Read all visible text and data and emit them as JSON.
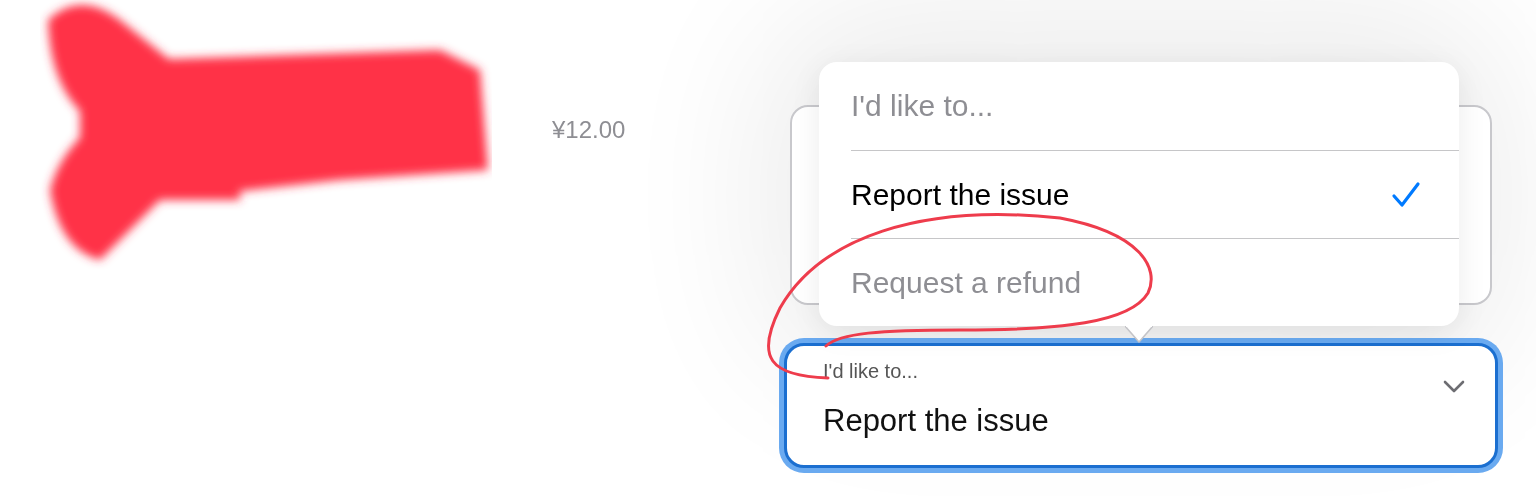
{
  "price": "¥12.00",
  "menu": {
    "header": "I'd like to...",
    "items": [
      {
        "label": "Report the issue",
        "selected": true,
        "disabled": false
      },
      {
        "label": "Request a refund",
        "selected": false,
        "disabled": true
      }
    ]
  },
  "field": {
    "label": "I'd like to...",
    "value": "Report the issue",
    "focused": true
  }
}
